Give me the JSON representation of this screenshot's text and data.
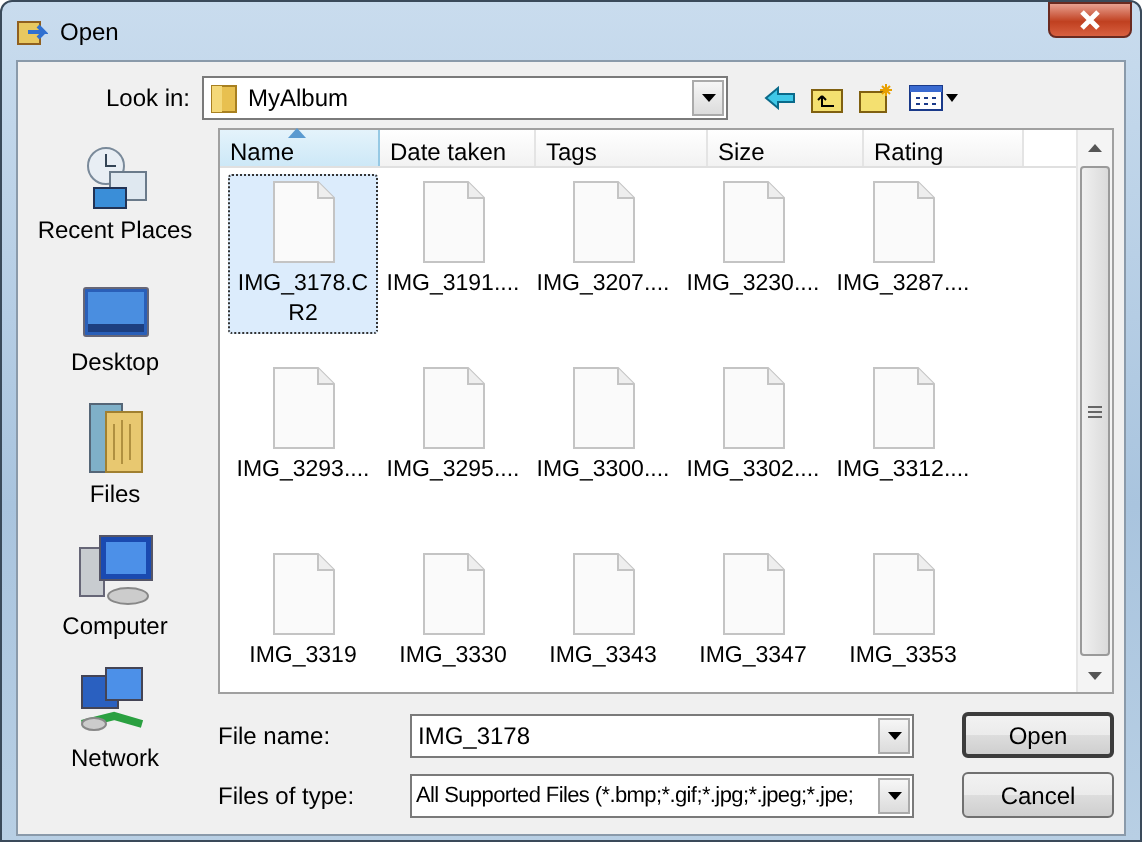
{
  "window": {
    "title": "Open"
  },
  "look_in": {
    "label": "Look in:",
    "value": "MyAlbum"
  },
  "places": [
    {
      "label": "Recent Places",
      "kind": "recent"
    },
    {
      "label": "Desktop",
      "kind": "desktop"
    },
    {
      "label": "Files",
      "kind": "files"
    },
    {
      "label": "Computer",
      "kind": "computer"
    },
    {
      "label": "Network",
      "kind": "network"
    }
  ],
  "columns": [
    {
      "label": "Name",
      "sorted": true
    },
    {
      "label": "Date taken",
      "sorted": false
    },
    {
      "label": "Tags",
      "sorted": false
    },
    {
      "label": "Size",
      "sorted": false
    },
    {
      "label": "Rating",
      "sorted": false
    }
  ],
  "files": [
    {
      "name": "IMG_3178.CR2",
      "selected": true
    },
    {
      "name": "IMG_3191....",
      "selected": false
    },
    {
      "name": "IMG_3207....",
      "selected": false
    },
    {
      "name": "IMG_3230....",
      "selected": false
    },
    {
      "name": "IMG_3287....",
      "selected": false
    },
    {
      "name": "IMG_3293....",
      "selected": false
    },
    {
      "name": "IMG_3295....",
      "selected": false
    },
    {
      "name": "IMG_3300....",
      "selected": false
    },
    {
      "name": "IMG_3302....",
      "selected": false
    },
    {
      "name": "IMG_3312....",
      "selected": false
    },
    {
      "name": "IMG_3319",
      "selected": false
    },
    {
      "name": "IMG_3330",
      "selected": false
    },
    {
      "name": "IMG_3343",
      "selected": false
    },
    {
      "name": "IMG_3347",
      "selected": false
    },
    {
      "name": "IMG_3353",
      "selected": false
    }
  ],
  "file_name": {
    "label": "File name:",
    "value": "IMG_3178"
  },
  "file_type": {
    "label": "Files of type:",
    "value": "All Supported Files (*.bmp;*.gif;*.jpg;*.jpeg;*.jpe;"
  },
  "buttons": [
    "Open",
    "Cancel"
  ]
}
